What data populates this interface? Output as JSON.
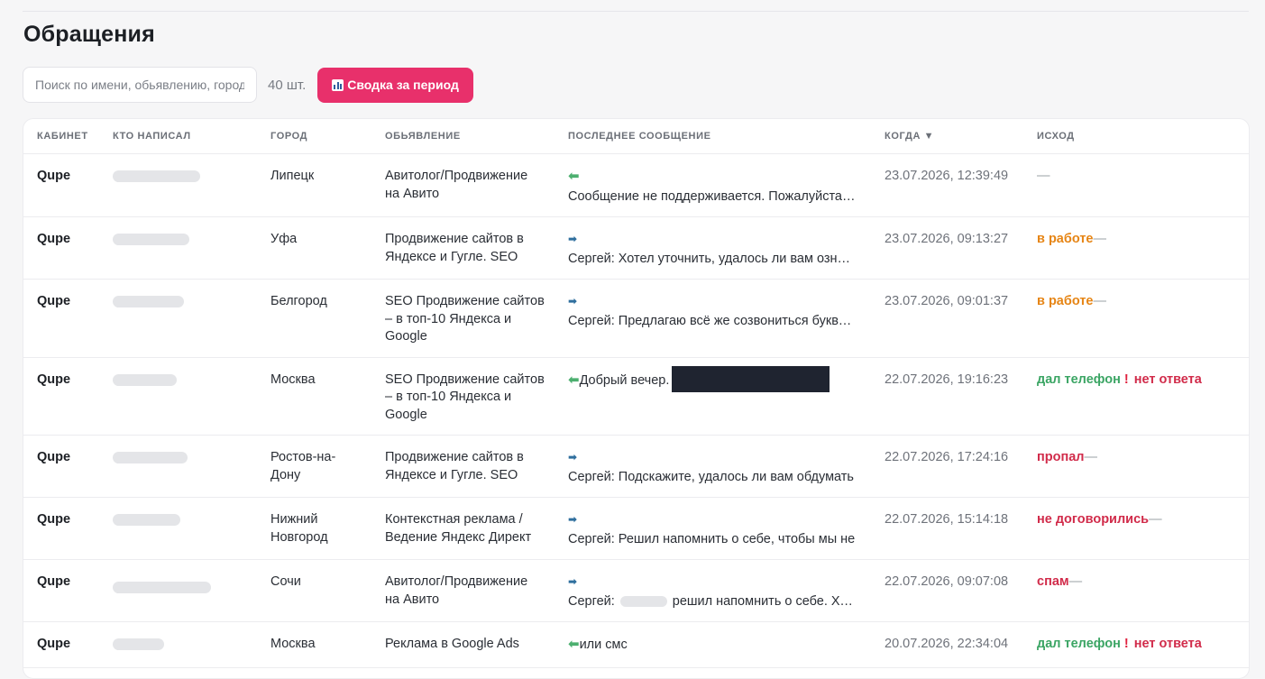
{
  "page": {
    "title": "Обращения"
  },
  "toolbar": {
    "search_placeholder": "Поиск по имени, обьявлению, городу",
    "count": "40 шт.",
    "summary_label": "Сводка за период"
  },
  "columns": {
    "cabinet": "КАБИНЕТ",
    "author": "КТО НАПИСАЛ",
    "city": "ГОРОД",
    "ad": "ОБЬЯВЛЕНИЕ",
    "last_message": "ПОСЛЕДНЕЕ СООБЩЕНИЕ",
    "when": "КОГДА ▼",
    "outcome": "ИСХОД"
  },
  "rows": [
    {
      "cabinet": "Qupe",
      "city": "Липецк",
      "ad": "Авитолог/Продвижение на Авито",
      "direction": "in",
      "message": "Сообщение не поддерживается. Пожалуйста, обновите приложение",
      "date": "23.07.2026, 12:39:49",
      "outcome": "—"
    },
    {
      "cabinet": "Qupe",
      "city": "Уфа",
      "ad": "Продвижение сайтов в Яндексе и Гугле. SEO",
      "direction": "out",
      "message": "Сергей: Хотел уточнить, удалось ли вам ознакомиться",
      "date": "23.07.2026, 09:13:27",
      "outcome": "в работе",
      "sep": "—"
    },
    {
      "cabinet": "Qupe",
      "city": "Белгород",
      "ad": "SEO Продвижение сайтов – в топ-10 Яндекса и Google",
      "direction": "out",
      "message": "Сергей: Предлагаю всё же созвониться буквально",
      "date": "23.07.2026, 09:01:37",
      "outcome": "в работе",
      "sep": "—"
    },
    {
      "cabinet": "Qupe",
      "city": "Москва",
      "ad": "SEO Продвижение сайтов – в топ-10 Яндекса и Google",
      "direction": "in",
      "message": "Добрый вечер.",
      "date": "22.07.2026, 19:16:23",
      "outcome": "дал телефон",
      "excl": "!",
      "extra": "нет ответа"
    },
    {
      "cabinet": "Qupe",
      "city": "Ростов-на-Дону",
      "ad": "Продвижение сайтов в Яндексе и Гугле. SEO",
      "direction": "out",
      "message": "Сергей: Подскажите, удалось ли вам обдумать",
      "date": "22.07.2026, 17:24:16",
      "outcome": "пропал",
      "sep": "—"
    },
    {
      "cabinet": "Qupe",
      "city": "Нижний Новгород",
      "ad": "Контекстная реклама / Ведение Яндекс Директ",
      "direction": "out",
      "message": "Сергей: Решил напомнить о себе, чтобы мы не",
      "date": "22.07.2026, 15:14:18",
      "outcome": "не договорились",
      "sep": "—"
    },
    {
      "cabinet": "Qupe",
      "city": "Сочи",
      "ad": "Авитолог/Продвижение на Авито",
      "direction": "out",
      "message_prefix": "Сергей:",
      "message_suffix": "решил напомнить о себе. Хотел",
      "date": "22.07.2026, 09:07:08",
      "outcome": "спам",
      "sep": "—"
    },
    {
      "cabinet": "Qupe",
      "city": "Москва",
      "ad": "Реклама в Google Ads",
      "direction": "in",
      "message": "или смс",
      "date": "20.07.2026, 22:34:04",
      "outcome": "дал телефон",
      "excl": "!",
      "extra": "нет ответа"
    }
  ],
  "colors": {
    "accent": "#e8306b",
    "orange": "#e68515",
    "green": "#3ba564",
    "red": "#d12b4a"
  },
  "icons": {
    "summary": "bar-chart-icon",
    "incoming": "arrow-left-icon",
    "outgoing": "arrow-right-icon"
  }
}
